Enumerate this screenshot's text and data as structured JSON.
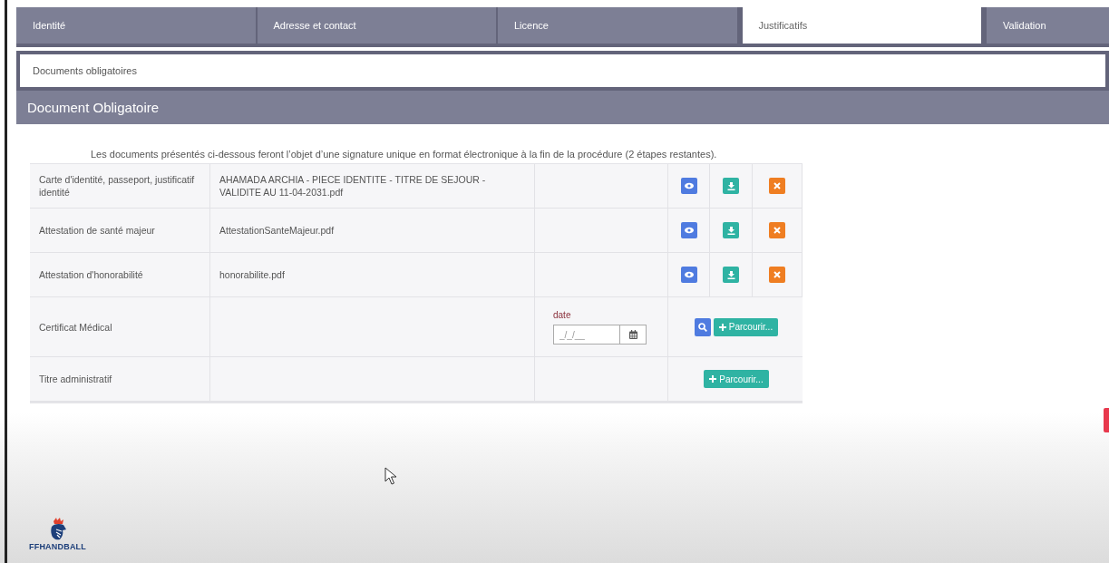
{
  "tabs": [
    {
      "label": "Identité",
      "selected": false
    },
    {
      "label": "Adresse et contact",
      "selected": false
    },
    {
      "label": "Licence",
      "selected": false
    },
    {
      "label": "Justificatifs",
      "selected": true
    },
    {
      "label": "Validation",
      "selected": false
    }
  ],
  "section_tab": "Documents obligatoires",
  "panel_title": "Document Obligatoire",
  "note": "Les documents présentés ci-dessous feront l’objet d’une signature unique en format électronique à la fin de la procédure (2 étapes restantes).",
  "documents": [
    {
      "label": "Carte d'identité, passeport, justificatif identité",
      "file": "AHAMADA ARCHIA - PIECE IDENTITE - TITRE DE SEJOUR -VALIDITE AU 11-04-2031.pdf",
      "kind": "uploaded"
    },
    {
      "label": "Attestation de santé majeur",
      "file": "AttestationSanteMajeur.pdf",
      "kind": "uploaded"
    },
    {
      "label": "Attestation d'honorabilité",
      "file": "honorabilite.pdf",
      "kind": "uploaded"
    },
    {
      "label": "Certificat Médical",
      "kind": "dated",
      "date_label": "date",
      "date_placeholder": "_/_/__",
      "browse": "Parcourir..."
    },
    {
      "label": "Titre administratif",
      "kind": "upload",
      "browse": "Parcourir..."
    }
  ],
  "logo_text": "FFHANDBALL"
}
